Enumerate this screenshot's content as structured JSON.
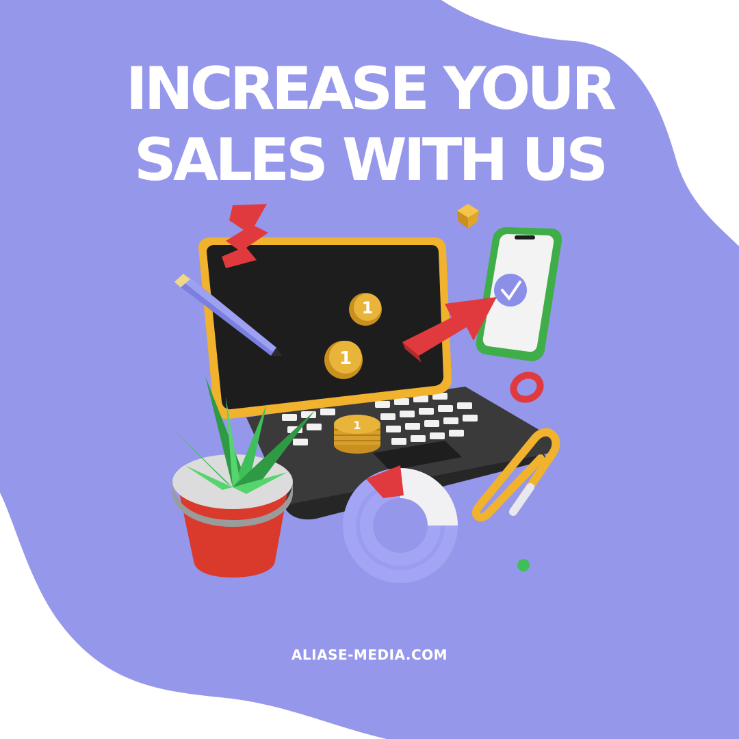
{
  "headline": {
    "line1": "INCREASE YOUR",
    "line2": "SALES WITH US"
  },
  "website": "ALIASE-MEDIA.COM",
  "coin_label": "1",
  "icons": [
    "zigzag-icon",
    "pencil-icon",
    "laptop-icon",
    "coin-icon",
    "arrow-up-icon",
    "phone-icon",
    "checkmark-icon",
    "cube-icon",
    "ring-icon",
    "plant-icon",
    "paperclip-icon",
    "donut-chart-icon",
    "ball-icon"
  ],
  "colors": {
    "background_blob": "#9597ea",
    "page": "#ffffff",
    "text": "#ffffff",
    "laptop_screen": "#1d1d1d",
    "laptop_frame": "#f1b22e",
    "accent_red": "#e03a3e",
    "phone_green": "#3fae49",
    "coin_gold": "#e9b43a",
    "plant_green": "#3fbf5a",
    "donut_lavender": "#a3a5f4"
  }
}
